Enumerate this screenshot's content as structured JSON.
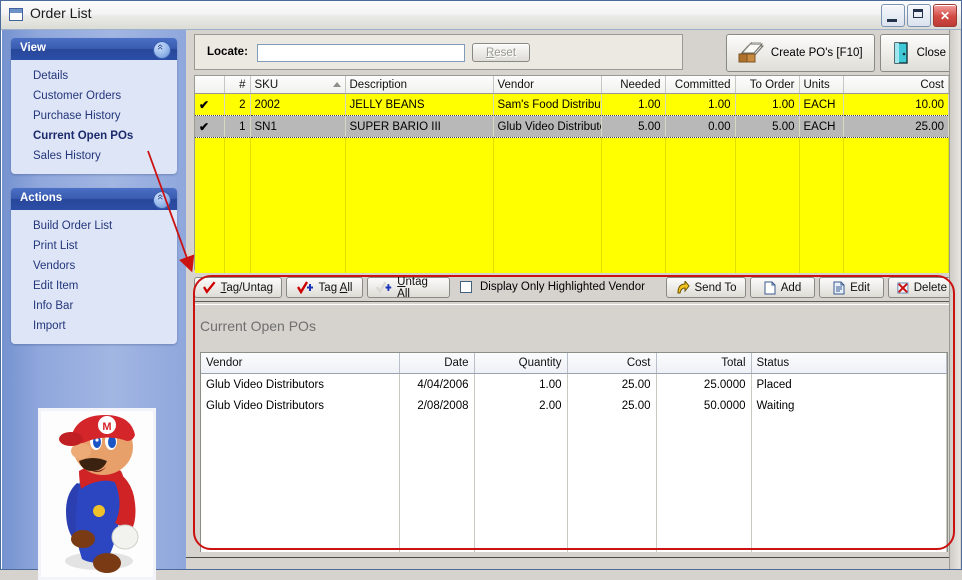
{
  "window": {
    "title": "Order List",
    "icon": "window-icon",
    "controls": {
      "minimize": "Minimize",
      "maximize": "Maximize",
      "close": "Close"
    }
  },
  "sidebar": {
    "groups": [
      {
        "title": "View",
        "collapse_icon": "chevron-up-icon",
        "items": [
          {
            "label": "Details",
            "selected": false
          },
          {
            "label": "Customer Orders",
            "selected": false
          },
          {
            "label": "Purchase History",
            "selected": false
          },
          {
            "label": "Current Open POs",
            "selected": true
          },
          {
            "label": "Sales History",
            "selected": false
          }
        ]
      },
      {
        "title": "Actions",
        "collapse_icon": "chevron-up-icon",
        "items": [
          {
            "label": "Build Order List",
            "selected": false
          },
          {
            "label": "Print List",
            "selected": false
          },
          {
            "label": "Vendors",
            "selected": false
          },
          {
            "label": "Edit Item",
            "selected": false
          },
          {
            "label": "Info Bar",
            "selected": false
          },
          {
            "label": "Import",
            "selected": false
          }
        ]
      }
    ],
    "image_alt": "mario-character-image"
  },
  "toolbar": {
    "locate_label": "Locate:",
    "locate_value": "",
    "locate_placeholder": "",
    "reset_label": "Reset",
    "create_po_label": "Create PO's [F10]",
    "create_po_icon": "card-file-box-icon",
    "close_label": "Close",
    "close_icon": "exit-door-icon"
  },
  "order_grid": {
    "columns": [
      {
        "key": "tag",
        "label": "",
        "align": "left"
      },
      {
        "key": "num",
        "label": "#",
        "align": "right"
      },
      {
        "key": "sku",
        "label": "SKU",
        "align": "left",
        "sorted": "asc"
      },
      {
        "key": "description",
        "label": "Description",
        "align": "left"
      },
      {
        "key": "vendor",
        "label": "Vendor",
        "align": "left"
      },
      {
        "key": "needed",
        "label": "Needed",
        "align": "right"
      },
      {
        "key": "committed",
        "label": "Committed",
        "align": "right"
      },
      {
        "key": "to_order",
        "label": "To Order",
        "align": "right"
      },
      {
        "key": "units",
        "label": "Units",
        "align": "left"
      },
      {
        "key": "cost",
        "label": "Cost",
        "align": "right"
      }
    ],
    "rows": [
      {
        "tag": "✔",
        "num": "2",
        "sku": "2002",
        "description": "JELLY BEANS",
        "vendor": "Sam's Food Distribution",
        "needed": "1.00",
        "committed": "1.00",
        "to_order": "1.00",
        "units": "EACH",
        "cost": "10.00",
        "style": "highlighted"
      },
      {
        "tag": "✔",
        "num": "1",
        "sku": "SN1",
        "description": "SUPER BARIO III",
        "vendor": "Glub Video Distributors",
        "needed": "5.00",
        "committed": "0.00",
        "to_order": "5.00",
        "units": "EACH",
        "cost": "25.00",
        "style": "selected"
      }
    ]
  },
  "grid_toolbar": {
    "tag_untag_label": "Tag/Untag",
    "tag_untag_icon": "red-check-icon",
    "tag_all_label": "Tag All",
    "tag_all_icon": "red-check-plus-icon",
    "untag_all_label": "Untag All",
    "untag_all_icon": "blank-check-plus-icon",
    "display_only_label": "Display Only Highlighted Vendor",
    "display_only_checked": false,
    "send_to_label": "Send To",
    "send_to_icon": "yellow-arrow-icon",
    "add_label": "Add",
    "add_icon": "new-page-icon",
    "edit_label": "Edit",
    "edit_icon": "document-edit-icon",
    "delete_label": "Delete",
    "delete_icon": "red-x-icon"
  },
  "bottom_panel": {
    "title": "Current Open POs",
    "columns": [
      {
        "key": "vendor",
        "label": "Vendor",
        "align": "left"
      },
      {
        "key": "date",
        "label": "Date",
        "align": "right"
      },
      {
        "key": "quantity",
        "label": "Quantity",
        "align": "right"
      },
      {
        "key": "cost",
        "label": "Cost",
        "align": "right"
      },
      {
        "key": "total",
        "label": "Total",
        "align": "right"
      },
      {
        "key": "status",
        "label": "Status",
        "align": "left"
      }
    ],
    "rows": [
      {
        "vendor": "Glub Video Distributors",
        "date": "4/04/2006",
        "quantity": "1.00",
        "cost": "25.00",
        "total": "25.0000",
        "status": "Placed"
      },
      {
        "vendor": "Glub Video Distributors",
        "date": "2/08/2008",
        "quantity": "2.00",
        "cost": "25.00",
        "total": "50.0000",
        "status": "Waiting"
      }
    ]
  },
  "annotation": {
    "highlight_color": "#cc1111",
    "arrow": "red-arrow-pointing-to-current-open-pos-panel"
  }
}
